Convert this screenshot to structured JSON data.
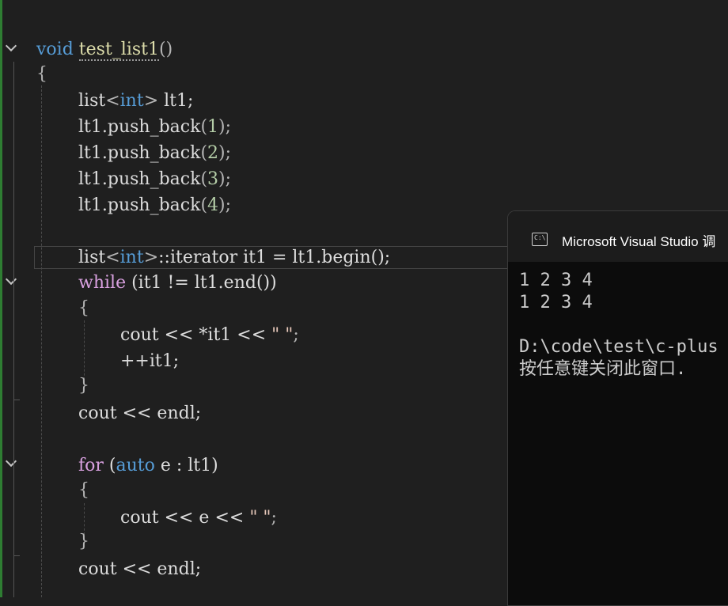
{
  "editor": {
    "lines": [
      {
        "kw": "void",
        "fn": "test_list1",
        "parens": "()"
      },
      {
        "text": "{"
      },
      {
        "a": "list",
        "b": "<",
        "c": "int",
        "d": ">",
        "e": " lt1;"
      },
      {
        "a": "lt1.push_back",
        "b": "(",
        "c": "1",
        "d": ");"
      },
      {
        "a": "lt1.push_back",
        "b": "(",
        "c": "2",
        "d": ");"
      },
      {
        "a": "lt1.push_back",
        "b": "(",
        "c": "3",
        "d": ");"
      },
      {
        "a": "lt1.push_back",
        "b": "(",
        "c": "4",
        "d": ");"
      },
      {
        "a": "list",
        "b": "<",
        "c": "int",
        "d": ">",
        "e": "::iterator it1 = lt1.begin();"
      },
      {
        "kw": "while",
        "rest": " (it1 != lt1.end())"
      },
      {
        "text": "{"
      },
      {
        "a": "cout << *it1 << ",
        "str": "\" \"",
        "end": ";"
      },
      {
        "text": "++it1;"
      },
      {
        "text": "}"
      },
      {
        "text": "cout << endl;"
      },
      {
        "kw": "for",
        "p1": " (",
        "kw2": "auto",
        "rest": " e : lt1)"
      },
      {
        "text": "{"
      },
      {
        "a": "cout << e << ",
        "str": "\" \"",
        "end": ";"
      },
      {
        "text": "}"
      },
      {
        "text": "cout << endl;"
      }
    ]
  },
  "console": {
    "icon": "C:\\",
    "title": "Microsoft Visual Studio 调",
    "output_lines": [
      "1 2 3 4",
      "1 2 3 4",
      "",
      "D:\\code\\test\\c-plus",
      "按任意键关闭此窗口."
    ]
  },
  "colors": {
    "background": "#1f1f1f",
    "keyword": "#569cd6",
    "control_keyword": "#d8a0df",
    "number": "#b5cea8",
    "string": "#e8c9bb",
    "console_bg": "#0c0c0c"
  }
}
